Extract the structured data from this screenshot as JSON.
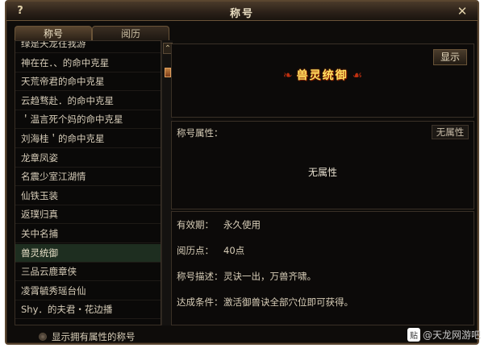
{
  "window": {
    "title": "称号"
  },
  "tabs": [
    {
      "label": "称号",
      "active": true
    },
    {
      "label": "阅历",
      "active": false
    }
  ],
  "title_list": [
    {
      "label": "绿是天龙往我游"
    },
    {
      "label": "神在在．、的命中克星"
    },
    {
      "label": "天荒帝君的命中克星"
    },
    {
      "label": "云趋骛赴．的命中克星"
    },
    {
      "label": "＇温言死个妈的命中克星"
    },
    {
      "label": "刘海桂＇的命中克星"
    },
    {
      "label": "龙章凤姿"
    },
    {
      "label": "名震少室江湖情"
    },
    {
      "label": "仙铁玉装"
    },
    {
      "label": "返璞归真"
    },
    {
      "label": "关中名捕"
    },
    {
      "label": "兽灵统御",
      "selected": true
    },
    {
      "label": "三品云鹿章侠"
    },
    {
      "label": "凌霄毓秀瑶台仙"
    },
    {
      "label": "Shy．的夫君・花边播"
    }
  ],
  "preview": {
    "show_button": "显示",
    "emblem_text": "兽灵统御"
  },
  "attributes": {
    "label": "称号属性：",
    "button": "无属性",
    "value": "无属性"
  },
  "details": [
    {
      "label": "有效期：",
      "value": "永久使用"
    },
    {
      "label": "阅历点：",
      "value": "40点"
    },
    {
      "label": "称号描述：",
      "value": "灵诀一出，万兽齐啸。"
    },
    {
      "label": "达成条件：",
      "value": "激活御兽诀全部穴位即可获得。"
    }
  ],
  "footer": {
    "filter_label": "显示拥有属性的称号"
  },
  "watermark": {
    "badge": "贴",
    "text": "@天龙网游吧"
  },
  "colors": {
    "background": "#0e0c0a",
    "border": "#5a4630",
    "selected_row": "#1e2e20",
    "emblem": "#ffdf60"
  }
}
